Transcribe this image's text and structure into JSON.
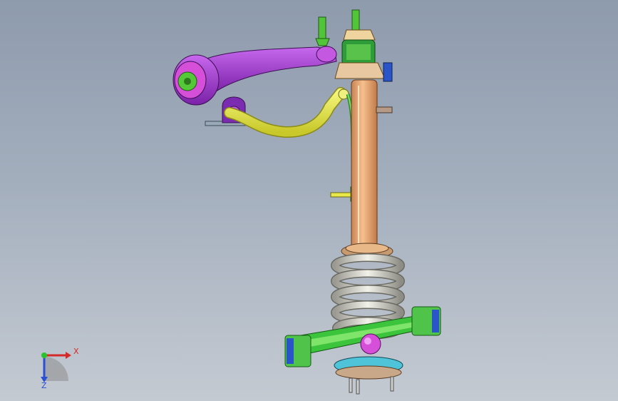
{
  "viewport": {
    "background_top": "#8e9bad",
    "background_bottom": "#c4cad2"
  },
  "triad": {
    "x_label": "X",
    "z_label": "Z"
  },
  "part_colors": {
    "upper_control_arm": "#a63fd8",
    "bushing": "#d63fd8",
    "stabilizer_link": "#e8e84a",
    "strut_body": "#f0b57e",
    "coil_spring": "#d8d8d0",
    "strut_mount": "#2f9c3a",
    "lower_arm": "#3cc43c",
    "hub": "#4fc3d8",
    "ball_joint": "#d64fd8",
    "bracket": "#d8b8a0"
  }
}
